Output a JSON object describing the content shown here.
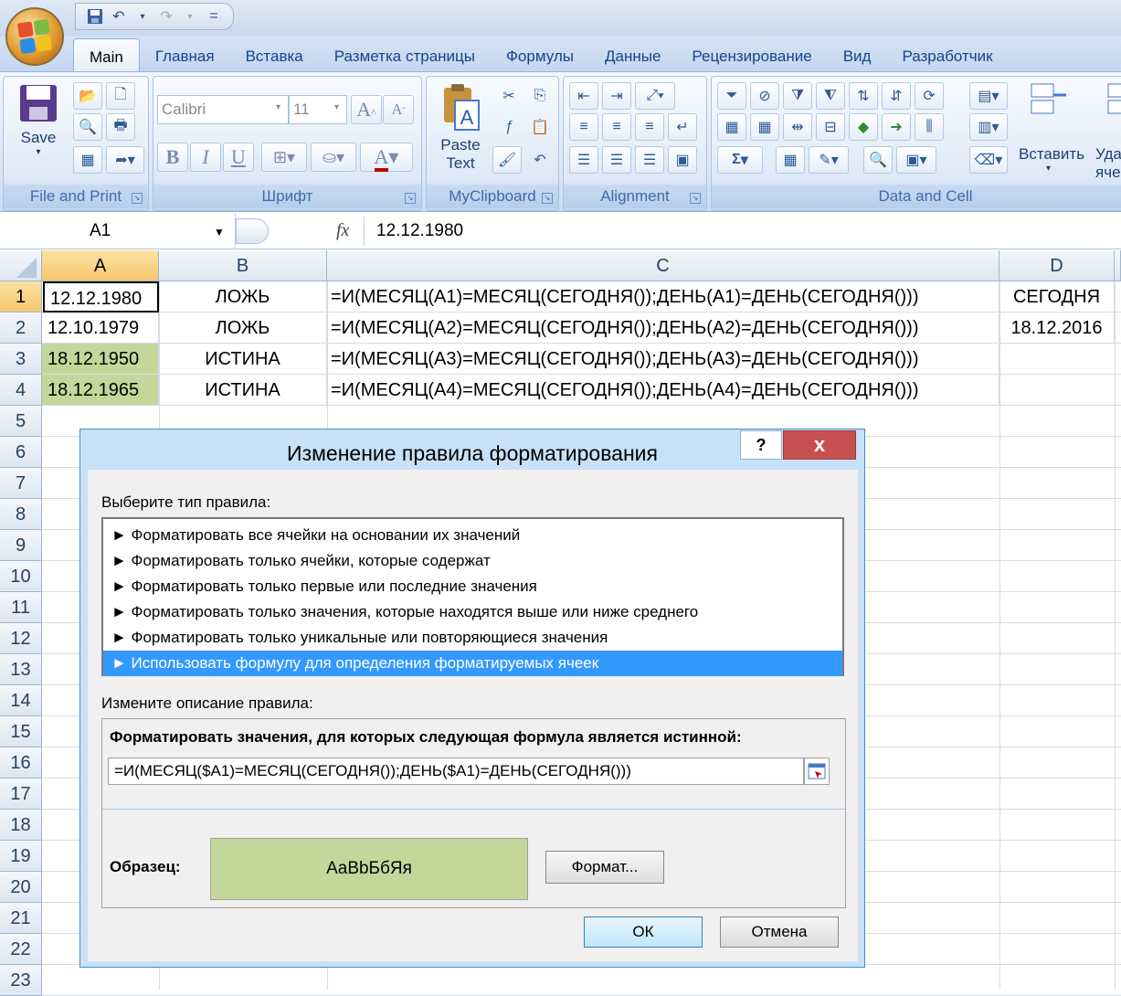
{
  "qat": {
    "save_icon": "save-icon",
    "undo_icon": "undo-icon",
    "redo_icon": "redo-icon",
    "customize": "="
  },
  "tabs": [
    "Main",
    "Главная",
    "Вставка",
    "Разметка страницы",
    "Формулы",
    "Данные",
    "Рецензирование",
    "Вид",
    "Разработчик"
  ],
  "ribbon": {
    "groups": {
      "file_print": "File and Print",
      "font": "Шрифт",
      "clipboard": "MyClipboard",
      "alignment": "Alignment",
      "data_cell": "Data and Cell"
    },
    "save_label": "Save",
    "paste_line1": "Paste",
    "paste_line2": "Text",
    "font_name": "Calibri",
    "font_size": "11",
    "bold": "B",
    "italic": "I",
    "underline": "U",
    "insert_label": "Вставить",
    "delete_label_1": "Уда",
    "delete_label_2": "яче",
    "sum_symbol": "Σ"
  },
  "formula_bar": {
    "name_box": "A1",
    "fx": "fx",
    "content": "12.12.1980"
  },
  "sheet": {
    "columns": [
      "A",
      "B",
      "C",
      "D"
    ],
    "rows": [
      "1",
      "2",
      "3",
      "4",
      "5",
      "6",
      "7",
      "8",
      "9",
      "10",
      "11",
      "12",
      "13",
      "14",
      "15",
      "16",
      "17",
      "18",
      "19",
      "20",
      "21",
      "22",
      "23"
    ],
    "cells": {
      "A1": "12.12.1980",
      "B1": "ЛОЖЬ",
      "C1": "=И(МЕСЯЦ(A1)=МЕСЯЦ(СЕГОДНЯ());ДЕНЬ(A1)=ДЕНЬ(СЕГОДНЯ()))",
      "D1": "СЕГОДНЯ",
      "A2": "12.10.1979",
      "B2": "ЛОЖЬ",
      "C2": "=И(МЕСЯЦ(A2)=МЕСЯЦ(СЕГОДНЯ());ДЕНЬ(A2)=ДЕНЬ(СЕГОДНЯ()))",
      "D2": "18.12.2016",
      "A3": "18.12.1950",
      "B3": "ИСТИНА",
      "C3": "=И(МЕСЯЦ(A3)=МЕСЯЦ(СЕГОДНЯ());ДЕНЬ(A3)=ДЕНЬ(СЕГОДНЯ()))",
      "A4": "18.12.1965",
      "B4": "ИСТИНА",
      "C4": "=И(МЕСЯЦ(A4)=МЕСЯЦ(СЕГОДНЯ());ДЕНЬ(A4)=ДЕНЬ(СЕГОДНЯ()))"
    },
    "highlight_color": "#c4d79b"
  },
  "dialog": {
    "title": "Изменение правила форматирования",
    "help": "?",
    "close": "x",
    "select_type_label": "Выберите тип правила:",
    "rules": [
      "► Форматировать все ячейки на основании их значений",
      "► Форматировать только ячейки, которые содержат",
      "► Форматировать только первые или последние значения",
      "► Форматировать только значения, которые находятся выше или ниже среднего",
      "► Форматировать только уникальные или повторяющиеся значения",
      "► Использовать формулу для определения форматируемых ячеек"
    ],
    "selected_rule_index": 5,
    "edit_desc_label": "Измените описание правила:",
    "formula_label": "Форматировать значения, для которых следующая формула является истинной:",
    "formula": "=И(МЕСЯЦ($A1)=МЕСЯЦ(СЕГОДНЯ());ДЕНЬ($A1)=ДЕНЬ(СЕГОДНЯ()))",
    "sample_label": "Образец:",
    "sample_text": "AaBbБбЯя",
    "sample_color": "#c4d79b",
    "format_button": "Формат...",
    "ok": "ОК",
    "cancel": "Отмена"
  }
}
